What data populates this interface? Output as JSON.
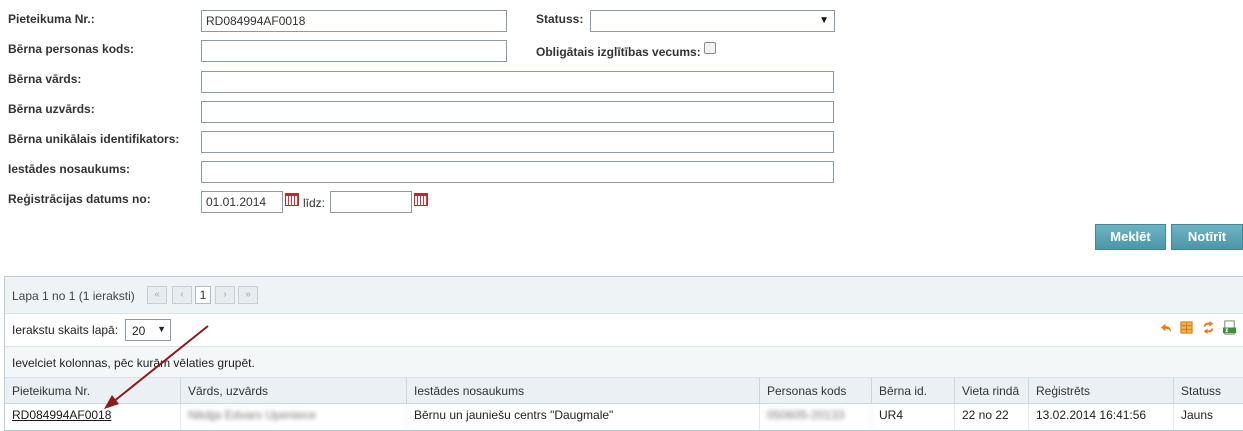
{
  "form": {
    "application_no": {
      "label": "Pieteikuma Nr.:",
      "value": "RD084994AF0018"
    },
    "status": {
      "label": "Statuss:",
      "value": ""
    },
    "personal_code": {
      "label": "Bērna personas kods:",
      "value": ""
    },
    "mandatory_age": {
      "label": "Obligātais izglītības vecums:",
      "checked": false
    },
    "first_name": {
      "label": "Bērna vārds:",
      "value": ""
    },
    "last_name": {
      "label": "Bērna uzvārds:",
      "value": ""
    },
    "unique_id": {
      "label": "Bērna unikālais identifikators:",
      "value": ""
    },
    "institution": {
      "label": "Iestādes nosaukums:",
      "value": ""
    },
    "reg_date": {
      "label": "Reģistrācijas datums no:",
      "from": "01.01.2014",
      "to_label": "līdz:",
      "to": ""
    }
  },
  "buttons": {
    "search": "Meklēt",
    "clear": "Notīrīt"
  },
  "grid": {
    "page_info": "Lapa 1 no 1 (1 ieraksti)",
    "pager": {
      "first": "«",
      "prev": "‹",
      "current": "1",
      "next": "›",
      "last": "»"
    },
    "per_page_label": "Ierakstu skaits lapā:",
    "per_page_value": "20",
    "grouping_hint": "Ievelciet kolonnas, pēc kurām vēlaties grupēt.",
    "columns": [
      "Pieteikuma Nr.",
      "Vārds, uzvārds",
      "Iestādes nosaukums",
      "Personas kods",
      "Bērna id.",
      "Vieta rindā",
      "Reģistrēts",
      "Statuss"
    ],
    "rows": [
      {
        "application_no": "RD084994AF0018",
        "name": "Nikāja Edvars Upeniece",
        "institution": "Bērnu un jauniešu centrs \"Daugmale\"",
        "personal_code": "050605-20133",
        "child_id": "UR4",
        "queue_place": "22 no 22",
        "registered": "13.02.2014 16:41:56",
        "status": "Jauns"
      }
    ]
  },
  "toolbar_icons": [
    "undo-icon",
    "grid-settings-icon",
    "refresh-icon",
    "export-excel-icon"
  ],
  "colors": {
    "button": "#4a97a8",
    "calendar": "#c1272d",
    "arrow": "#8b1a1a",
    "header": "#eaf0f3"
  }
}
